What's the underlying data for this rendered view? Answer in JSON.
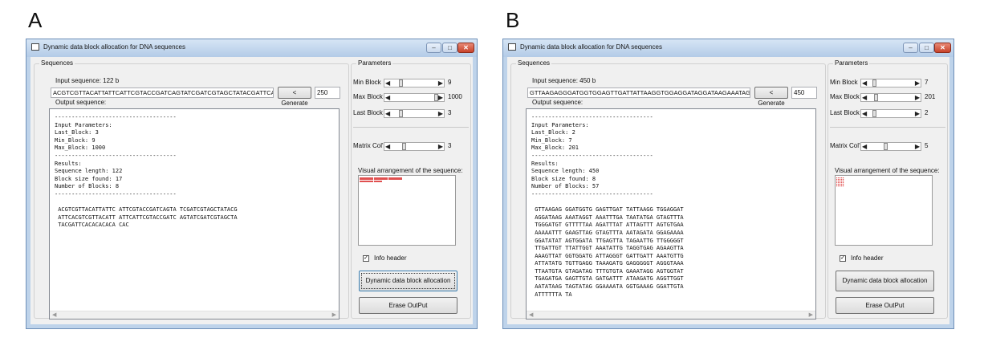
{
  "panels": [
    {
      "letter": "A",
      "title": "Dynamic data block allocation for DNA sequences",
      "sequences_label": "Sequences",
      "input_label": "Input sequence: 122 b",
      "input_value": "ACGTCGTTACATTATTCATTCGTACCGATCAGTATCGATCGTAGCTATACGATTCACGTCGTTACATT",
      "generate_label": "< Generate",
      "length_value": "250",
      "output_label": "Output sequence:",
      "output_lines": [
        "------------------------------------",
        "Input Parameters:",
        "Last_Block: 3",
        "Min_Block: 9",
        "Max_Block: 1000",
        "------------------------------------",
        "Results:",
        "Sequence length: 122",
        "Block size found: 17",
        "Number of Blocks: 8",
        "------------------------------------",
        "",
        " ACGTCGTTACATTATTC ATTCGTACCGATCAGTA TCGATCGTAGCTATACG",
        " ATTCACGTCGTTACATT ATTCATTCGTACCGATC AGTATCGATCGTAGCTA",
        " TACGATTCACACACACA CAC"
      ],
      "parameters_label": "Parameters",
      "min_block_label": "Min Block",
      "min_block_value": "9",
      "max_block_label": "Max Block",
      "max_block_value": "1000",
      "last_block_label": "Last Block",
      "last_block_value": "3",
      "matrix_cols_label": "Matrix Col's",
      "matrix_cols_value": "3",
      "visual_label": "Visual arrangement of the sequence:",
      "info_header_label": "Info header",
      "allocate_label": "Dynamic data block allocation",
      "erase_label": "Erase OutPut"
    },
    {
      "letter": "B",
      "title": "Dynamic data block allocation for DNA sequences",
      "sequences_label": "Sequences",
      "input_label": "Input sequence: 450 b",
      "input_value": "GTTAAGAGGGATGGTGGAGTTGATTATTAAGGTGGAGGATAGGATAAGAAATAGGTAAATTTGA",
      "generate_label": "< Generate",
      "length_value": "450",
      "output_label": "Output sequence:",
      "output_lines": [
        "------------------------------------",
        "Input Parameters:",
        "Last_Block: 2",
        "Min_Block: 7",
        "Max_Block: 201",
        "------------------------------------",
        "Results:",
        "Sequence length: 450",
        "Block size found: 8",
        "Number of Blocks: 57",
        "------------------------------------",
        "",
        " GTTAAGAG GGATGGTG GAGTTGAT TATTAAGG TGGAGGAT",
        " AGGATAAG AAATAGGT AAATTTGA TAATATGA GTAGTTTA",
        " TGGGATGT GTTTTTAA AGATTTAT ATTAGTTT AGTGTGAA",
        " AAAAATTT GAAGTTAG GTAGTTTA AATAGATA GGAGAAAA",
        " GGATATAT AGTGGATA TTGAGTTA TAGAATTG TTGGGGGT",
        " TTGATTGT TTATTGGT AAATATTG TAGGTGAG AGAAGTTA",
        " AAAGTTAT GGTGGATG ATTAGGGT GATTGATT AAATGTTG",
        " ATTATATG TGTTGAGG TAAAGATG GAGGGGGT AGGGTAAA",
        " TTAATGTA GTAGATAG TTTGTGTA GAAATAGG AGTGGTAT",
        " TGAGATGA GAGTTGTA GATGATTT ATAAGATG AGGTTGGT",
        " AATATAAG TAGTATAG GGAAAATA GGTGAAAG GGATTGTA",
        " ATTTTTTA TA"
      ],
      "parameters_label": "Parameters",
      "min_block_label": "Min Block",
      "min_block_value": "7",
      "max_block_label": "Max Block",
      "max_block_value": "201",
      "last_block_label": "Last Block",
      "last_block_value": "2",
      "matrix_cols_label": "Matrix Col's",
      "matrix_cols_value": "5",
      "visual_label": "Visual arrangement of the sequence:",
      "info_header_label": "Info header",
      "allocate_label": "Dynamic data block allocation",
      "erase_label": "Erase OutPut"
    }
  ],
  "icons": {
    "minimize": "minimize-icon",
    "maximize": "maximize-icon",
    "close": "close-icon",
    "app": "app-window-icon",
    "checkbox": "checkmark-icon"
  },
  "colors": {
    "visual_mark": "#e05050",
    "close_button": "#c7422a"
  }
}
